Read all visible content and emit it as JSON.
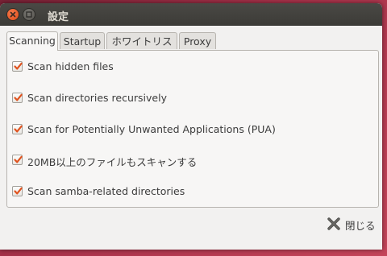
{
  "window": {
    "title": "設定"
  },
  "tabs": [
    {
      "label": "Scanning",
      "active": true
    },
    {
      "label": "Startup",
      "active": false
    },
    {
      "label": "ホワイトリスト",
      "active": false
    },
    {
      "label": "Proxy",
      "active": false
    }
  ],
  "options": [
    {
      "label": "Scan hidden files",
      "checked": true
    },
    {
      "label": "Scan directories recursively",
      "checked": true
    },
    {
      "label": "Scan for Potentially Unwanted Applications (PUA)",
      "checked": true
    },
    {
      "label": "20MB以上のファイルもスキャンする",
      "checked": true
    },
    {
      "label": "Scan samba-related directories",
      "checked": true
    }
  ],
  "footer": {
    "close_label": "閉じる"
  },
  "colors": {
    "check_accent": "#e0531f",
    "desktop": "#a8324a",
    "titlebar": "#3c3b37"
  }
}
